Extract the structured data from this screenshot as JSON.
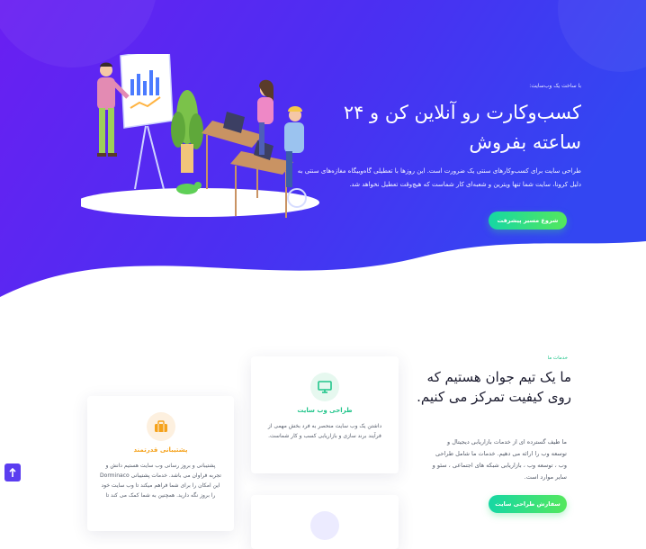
{
  "hero": {
    "kicker": "با ساخت یک وب‌سایت:",
    "title": "کسب‌وکارت رو آنلاین کن و ۲۴ ساعته بفروش",
    "description": "طراحی سایت برای کسب‌وکارهای سنتی یک ضرورت است. این روزها با تعطیلی گاه‌وبیگاه مغازه‌های سنتی به دلیل کرونا، سایت شما تنها ویترین و شعبه‌ای کار شماست که هیچ‌وقت تعطیل نخواهد شد.",
    "cta_label": "شروع مسیر پیشرفت"
  },
  "services": {
    "label": "خدمات ما",
    "title": "ما یک تیم جوان هستیم که روی کیفیت تمرکز می کنیم.",
    "description": "ما طیف گسترده ای از خدمات بازاریابی دیجیتال و توسعه وب را ارائه می دهیم. خدمات ما شامل طراحی وب ، توسعه وب ، بازاریابی شبکه های اجتماعی ، سئو و سایر موارد است.",
    "cta_label": "سفارش طراحی سایت"
  },
  "cards": [
    {
      "icon": "monitor-icon",
      "title": "طراحی وب سایت",
      "description": "داشتن یک وب سایت منحصر به فرد بخش مهمی از فرآیند برند سازی و بازاریابی کسب و کار شماست."
    },
    {
      "icon": "briefcase-icon",
      "title": "پشتیبانی قدرتمند",
      "description": "پشتیبانی و بروز رسانی وب سایت هستیم دانش و تجربه فراوان می باشد. خدمات پشتیبانی Dorminaco این امکان را برای شما فراهم میکند تا وب سایت خود را بروز نگه دارید. همچنین به شما کمک می کند تا"
    }
  ],
  "colors": {
    "hero_start": "#5a1ff0",
    "hero_end": "#3a44f2",
    "accent_green": "#22c58b",
    "card1_icon_bg": "#e6f8ef",
    "card2_icon_bg": "#fdf0df",
    "card2_icon": "#f5a21b",
    "scroll_btn": "#5b3df0"
  },
  "scroll_top_icon": "arrow-up-icon"
}
